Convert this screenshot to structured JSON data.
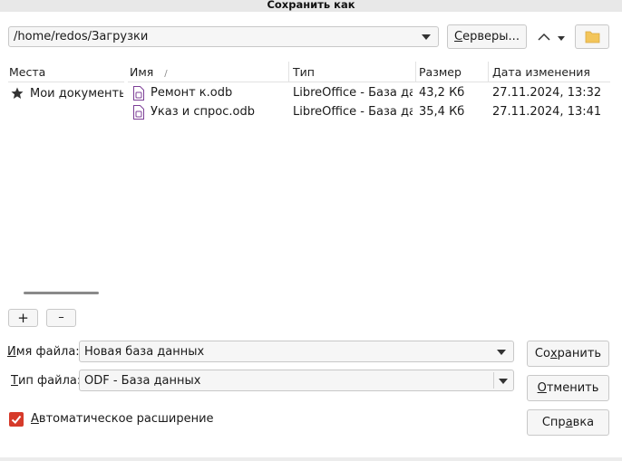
{
  "window": {
    "title": "Сохранить как"
  },
  "toolbar": {
    "path": "/home/redos/Загрузки",
    "servers_label": "Серверы...",
    "servers_accel": "С",
    "servers_rest": "ерверы..."
  },
  "places": {
    "header": "Места",
    "items": [
      {
        "label": "Мои документы",
        "icon": "star-icon"
      }
    ],
    "add_label": "+",
    "remove_label": "–"
  },
  "files": {
    "columns": {
      "name": "Имя",
      "type": "Тип",
      "size": "Размер",
      "modified": "Дата изменения"
    },
    "sort_indicator": "/",
    "rows": [
      {
        "name": "Ремонт к.odb",
        "type": "LibreOffice - База данных",
        "size": "43,2 Кб",
        "modified": "27.11.2024, 13:32"
      },
      {
        "name": "Указ и спрос.odb",
        "type": "LibreOffice - База данных",
        "size": "35,4 Кб",
        "modified": "27.11.2024, 13:41"
      }
    ]
  },
  "form": {
    "filename_label_accel": "И",
    "filename_label_rest": "мя файла:",
    "filename_value": "Новая база данных",
    "filetype_label_accel": "Т",
    "filetype_label_rest": "ип файла:",
    "filetype_value": "ODF - База данных",
    "auto_ext_accel": "А",
    "auto_ext_rest": "втоматическое расширение",
    "auto_ext_checked": true
  },
  "buttons": {
    "save_pre": "Со",
    "save_accel": "х",
    "save_post": "ранить",
    "cancel_accel": "О",
    "cancel_rest": "тменить",
    "help_pre": "Спр",
    "help_accel": "а",
    "help_post": "вка"
  },
  "colors": {
    "checkbox": "#d63a2a",
    "file_icon": "#7c3f97",
    "folder": "#f3c55a"
  }
}
